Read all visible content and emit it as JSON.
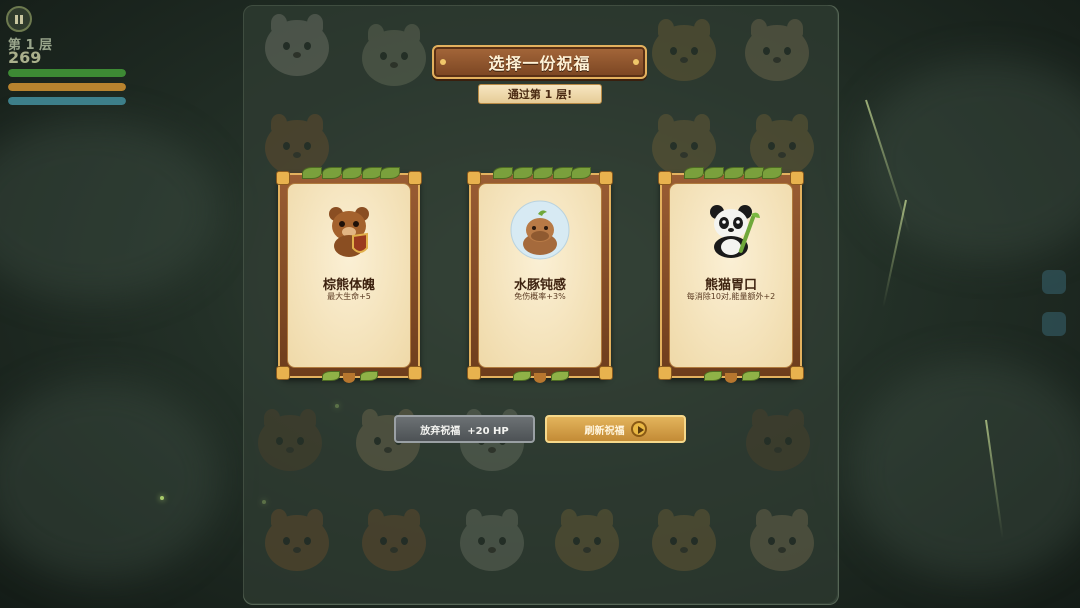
{
  "hud": {
    "floor_label": "第 1 层",
    "score": "269",
    "bars": [
      {
        "name": "hp",
        "color": "#3d8a34",
        "fill_percent": 100
      },
      {
        "name": "energy",
        "color": "#b8832e",
        "fill_percent": 100
      },
      {
        "name": "exp",
        "color": "#3d7f8a",
        "fill_percent": 100
      }
    ]
  },
  "dialog": {
    "title": "选择一份祝福",
    "subtitle": "通过第 1 层!"
  },
  "blessings": [
    {
      "name": "棕熊体魄",
      "desc": "最大生命+5",
      "icon": "brown-bear-shield-icon"
    },
    {
      "name": "水豚钝感",
      "desc": "免伤概率+3%",
      "icon": "capybara-icon"
    },
    {
      "name": "熊猫胃口",
      "desc": "每消除10对,能量额外+2",
      "icon": "panda-bamboo-icon"
    }
  ],
  "buttons": {
    "abandon": "放弃祝福  +20 HP",
    "refresh": "刷新祝福"
  },
  "colors": {
    "accent_gold": "#e3b15e",
    "wood": "#7a4522",
    "parchment": "#f3e2b8"
  }
}
